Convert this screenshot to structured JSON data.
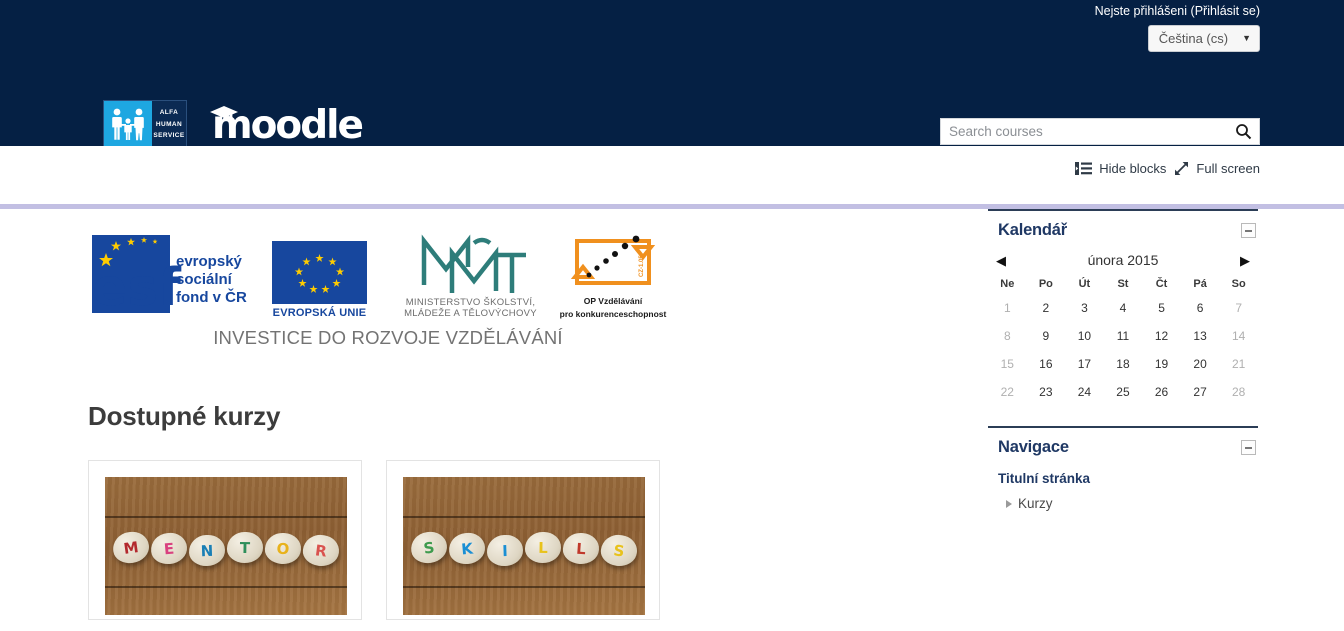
{
  "topbar": {
    "login_text": "Nejste přihlášeni",
    "login_link": "(Přihlásit se)"
  },
  "header": {
    "language_selector": {
      "value": "Čeština (cs)",
      "caret": "▼"
    },
    "logo": {
      "alfa_line1": "ALFA",
      "alfa_line2": "HUMAN",
      "alfa_line3": "SERVICE",
      "moodle_text": "moodle"
    },
    "search": {
      "placeholder": "Search courses",
      "value": "",
      "icon": "search-icon"
    }
  },
  "toolstrip": {
    "hide_blocks_label": "Hide blocks",
    "hide_blocks_icon": "blocks-list-icon",
    "full_screen_label": "Full screen",
    "full_screen_icon": "expand-arrows-icon"
  },
  "banner": {
    "esf_text_line1": "evropský",
    "esf_text_line2": "sociální",
    "esf_text_line3": "fond v ČR",
    "eu_caption": "EVROPSKÁ UNIE",
    "msmt_caption_line1": "MINISTERSTVO ŠKOLSTVÍ,",
    "msmt_caption_line2": "MLÁDEŽE A TĚLOVÝCHOVY",
    "opvk_caption_line1": "OP Vzdělávání",
    "opvk_caption_line2": "pro konkurenceschopnost",
    "opvk_side_text": "CZ-1.05",
    "investment_caption": "INVESTICE DO ROZVOJE VZDĚLÁVÁNÍ"
  },
  "main": {
    "page_title": "Dostupné kurzy",
    "courses": [
      {
        "name": "course-card-mentor",
        "image_alt": "MENTOR",
        "stones": [
          {
            "letter": "M",
            "color": "#b3292e"
          },
          {
            "letter": "E",
            "color": "#d9417f"
          },
          {
            "letter": "N",
            "color": "#1a7fb5"
          },
          {
            "letter": "T",
            "color": "#2f8f5b"
          },
          {
            "letter": "O",
            "color": "#e8b21c"
          },
          {
            "letter": "R",
            "color": "#d9534f"
          }
        ]
      },
      {
        "name": "course-card-skills",
        "image_alt": "SKILLS",
        "stones": [
          {
            "letter": "S",
            "color": "#3f9b4e"
          },
          {
            "letter": "K",
            "color": "#1a8fd4"
          },
          {
            "letter": "I",
            "color": "#1a8fd4"
          },
          {
            "letter": "L",
            "color": "#e8c21c"
          },
          {
            "letter": "L",
            "color": "#c0392b"
          },
          {
            "letter": "S",
            "color": "#e8c21c"
          }
        ]
      }
    ]
  },
  "sidebar": {
    "calendar": {
      "title": "Kalendář",
      "collapse_icon": "minimize-icon",
      "prev_arrow": "◀",
      "next_arrow": "▶",
      "month_label": "února 2015",
      "weekday_headers": [
        "Ne",
        "Po",
        "Út",
        "St",
        "Čt",
        "Pá",
        "So"
      ],
      "weeks": [
        [
          "1",
          "2",
          "3",
          "4",
          "5",
          "6",
          "7"
        ],
        [
          "8",
          "9",
          "10",
          "11",
          "12",
          "13",
          "14"
        ],
        [
          "15",
          "16",
          "17",
          "18",
          "19",
          "20",
          "21"
        ],
        [
          "22",
          "23",
          "24",
          "25",
          "26",
          "27",
          "28"
        ]
      ]
    },
    "navigation": {
      "title": "Navigace",
      "collapse_icon": "minimize-icon",
      "root_label": "Titulní stránka",
      "child_label": "Kurzy"
    }
  },
  "colors": {
    "header_navy": "#052044",
    "divider_lavender": "#c2bfe3",
    "block_title_blue": "#1f3864",
    "eu_blue": "#17479e",
    "eu_star_yellow": "#ffcc00",
    "msmt_teal": "#2e7d7a",
    "opvk_orange": "#f0901e",
    "alfa_cyan": "#1ea7e1"
  }
}
